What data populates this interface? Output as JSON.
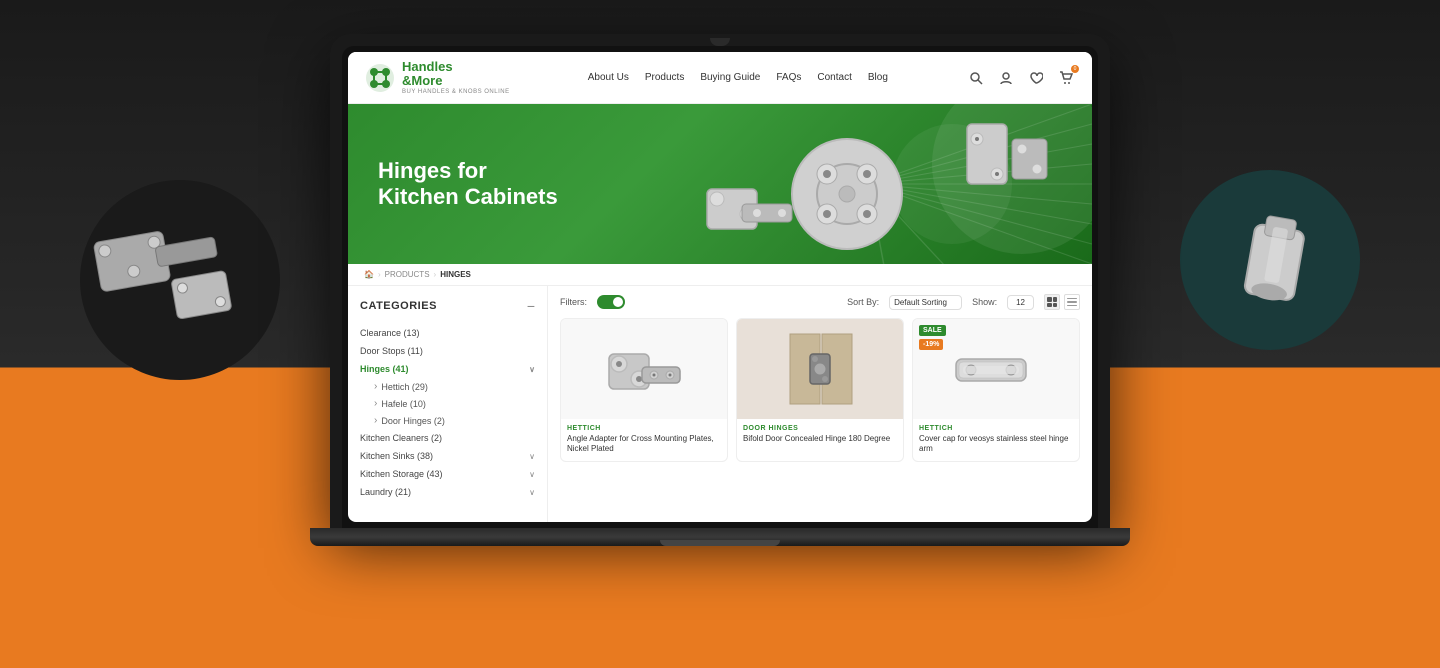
{
  "page": {
    "title": "Handles & More - Hinges for Kitchen Cabinets"
  },
  "nav": {
    "logo": {
      "title_line1": "Handles",
      "title_line2": "&More",
      "subtitle": "BUY HANDLES & KNOBS ONLINE"
    },
    "links": [
      "About Us",
      "Products",
      "Buying Guide",
      "FAQs",
      "Contact",
      "Blog"
    ],
    "cart_count": "0"
  },
  "hero": {
    "line1": "Hinges for",
    "line2": "Kitchen Cabinets"
  },
  "breadcrumb": {
    "items": [
      "🏠",
      "PRODUCTS",
      "HINGES"
    ]
  },
  "sidebar": {
    "title": "CATEGORIES",
    "categories": [
      {
        "name": "Clearance",
        "count": 13,
        "active": false,
        "has_children": false
      },
      {
        "name": "Door Stops",
        "count": 11,
        "active": false,
        "has_children": false
      },
      {
        "name": "Hinges",
        "count": 41,
        "active": true,
        "has_children": true
      },
      {
        "name": "Kitchen Cleaners",
        "count": 2,
        "active": false,
        "has_children": false
      },
      {
        "name": "Kitchen Sinks",
        "count": 38,
        "active": false,
        "has_children": true
      },
      {
        "name": "Kitchen Storage",
        "count": 43,
        "active": false,
        "has_children": true
      },
      {
        "name": "Laundry",
        "count": 21,
        "active": false,
        "has_children": true
      }
    ],
    "subcategories": [
      {
        "name": "Hettich",
        "count": 29
      },
      {
        "name": "Hafele",
        "count": 10
      },
      {
        "name": "Door Hinges",
        "count": 2
      }
    ]
  },
  "toolbar": {
    "filter_label": "Filters:",
    "sort_label": "Sort By:",
    "sort_default": "Default Sorting",
    "show_label": "Show:",
    "show_count": "12"
  },
  "products": [
    {
      "brand": "HETTICH",
      "name": "Angle Adapter for Cross Mounting Plates, Nickel Plated",
      "sale": false,
      "discount": null
    },
    {
      "brand": "DOOR HINGES",
      "name": "Bifold Door Concealed Hinge 180 Degree",
      "sale": false,
      "discount": null
    },
    {
      "brand": "HETTICH",
      "name": "Cover cap for veosys stainless steel hinge arm",
      "sale": true,
      "discount": "-19%"
    }
  ]
}
